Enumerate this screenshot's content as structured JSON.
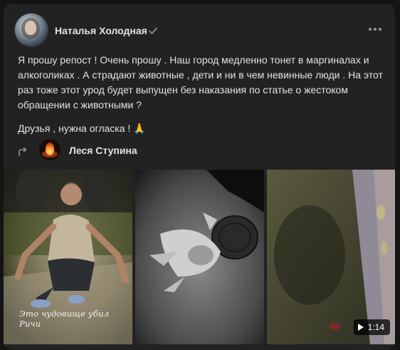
{
  "post": {
    "author": "Наталья Холодная",
    "text": [
      "Я прошу репост ! Очень прошу . Наш город медленно тонет в маргиналах и алкоголиках . А страдают животные , дети и ни в чем невинные люди . На этот раз тоже этот урод будет выпущен без наказания по статье о жестоком обращении с животными ?",
      "Друзья , нужна огласка ! 🙏"
    ],
    "reposted_from": "Леся Ступина"
  },
  "media": {
    "photo1_caption": "Это чудовище убил Ричи",
    "video_duration": "1:14"
  },
  "icons": [
    "avatar",
    "verified-icon",
    "more-icon",
    "repost-icon",
    "play-icon"
  ],
  "colors": {
    "background": "#141414",
    "card": "#222222",
    "text": "#e1e3e6",
    "muted": "#909499"
  }
}
